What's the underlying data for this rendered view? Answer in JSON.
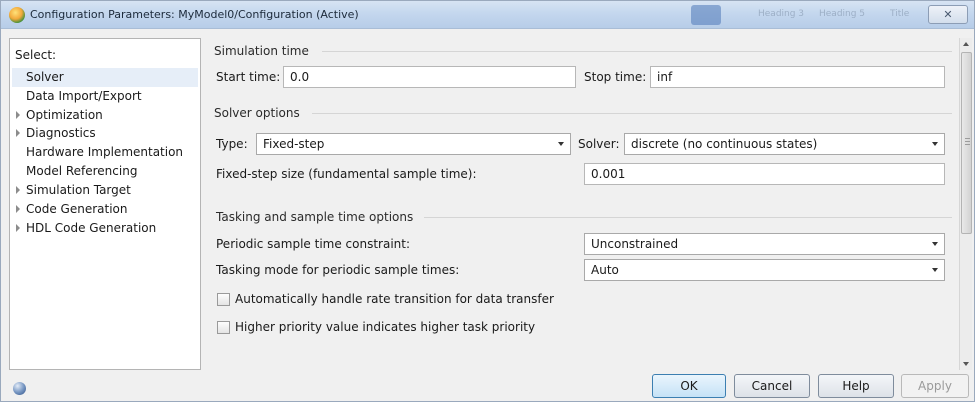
{
  "window": {
    "title": "Configuration Parameters: MyModel0/Configuration (Active)",
    "close_label": "✕",
    "ghost_titles": [
      "Heading 3",
      "Heading 5",
      "Title"
    ]
  },
  "left_pane": {
    "header": "Select:",
    "items": [
      {
        "label": "Solver",
        "expandable": false,
        "selected": true
      },
      {
        "label": "Data Import/Export",
        "expandable": false,
        "selected": false
      },
      {
        "label": "Optimization",
        "expandable": true,
        "selected": false
      },
      {
        "label": "Diagnostics",
        "expandable": true,
        "selected": false
      },
      {
        "label": "Hardware Implementation",
        "expandable": false,
        "selected": false
      },
      {
        "label": "Model Referencing",
        "expandable": false,
        "selected": false
      },
      {
        "label": "Simulation Target",
        "expandable": true,
        "selected": false
      },
      {
        "label": "Code Generation",
        "expandable": true,
        "selected": false
      },
      {
        "label": "HDL Code Generation",
        "expandable": true,
        "selected": false
      }
    ]
  },
  "simulation_time": {
    "header": "Simulation time",
    "start_label": "Start time:",
    "start_value": "0.0",
    "stop_label": "Stop time:",
    "stop_value": "inf"
  },
  "solver_options": {
    "header": "Solver options",
    "type_label": "Type:",
    "type_value": "Fixed-step",
    "solver_label": "Solver:",
    "solver_value": "discrete (no continuous states)",
    "step_label": "Fixed-step size (fundamental sample time):",
    "step_value": "0.001"
  },
  "tasking": {
    "header": "Tasking and sample time options",
    "periodic_label": "Periodic sample time constraint:",
    "periodic_value": "Unconstrained",
    "mode_label": "Tasking mode for periodic sample times:",
    "mode_value": "Auto",
    "rate_transition_label": "Automatically handle rate transition for data transfer",
    "rate_transition_checked": false,
    "priority_label": "Higher priority value indicates higher task priority",
    "priority_checked": false
  },
  "buttons": {
    "ok": "OK",
    "cancel": "Cancel",
    "help": "Help",
    "apply": "Apply"
  },
  "colors": {
    "titlebar": "#c4d7ee",
    "dialog_bg": "#f0f0f0",
    "selected_item": "#e6eef8",
    "ok_button": "#c5e2f6"
  }
}
